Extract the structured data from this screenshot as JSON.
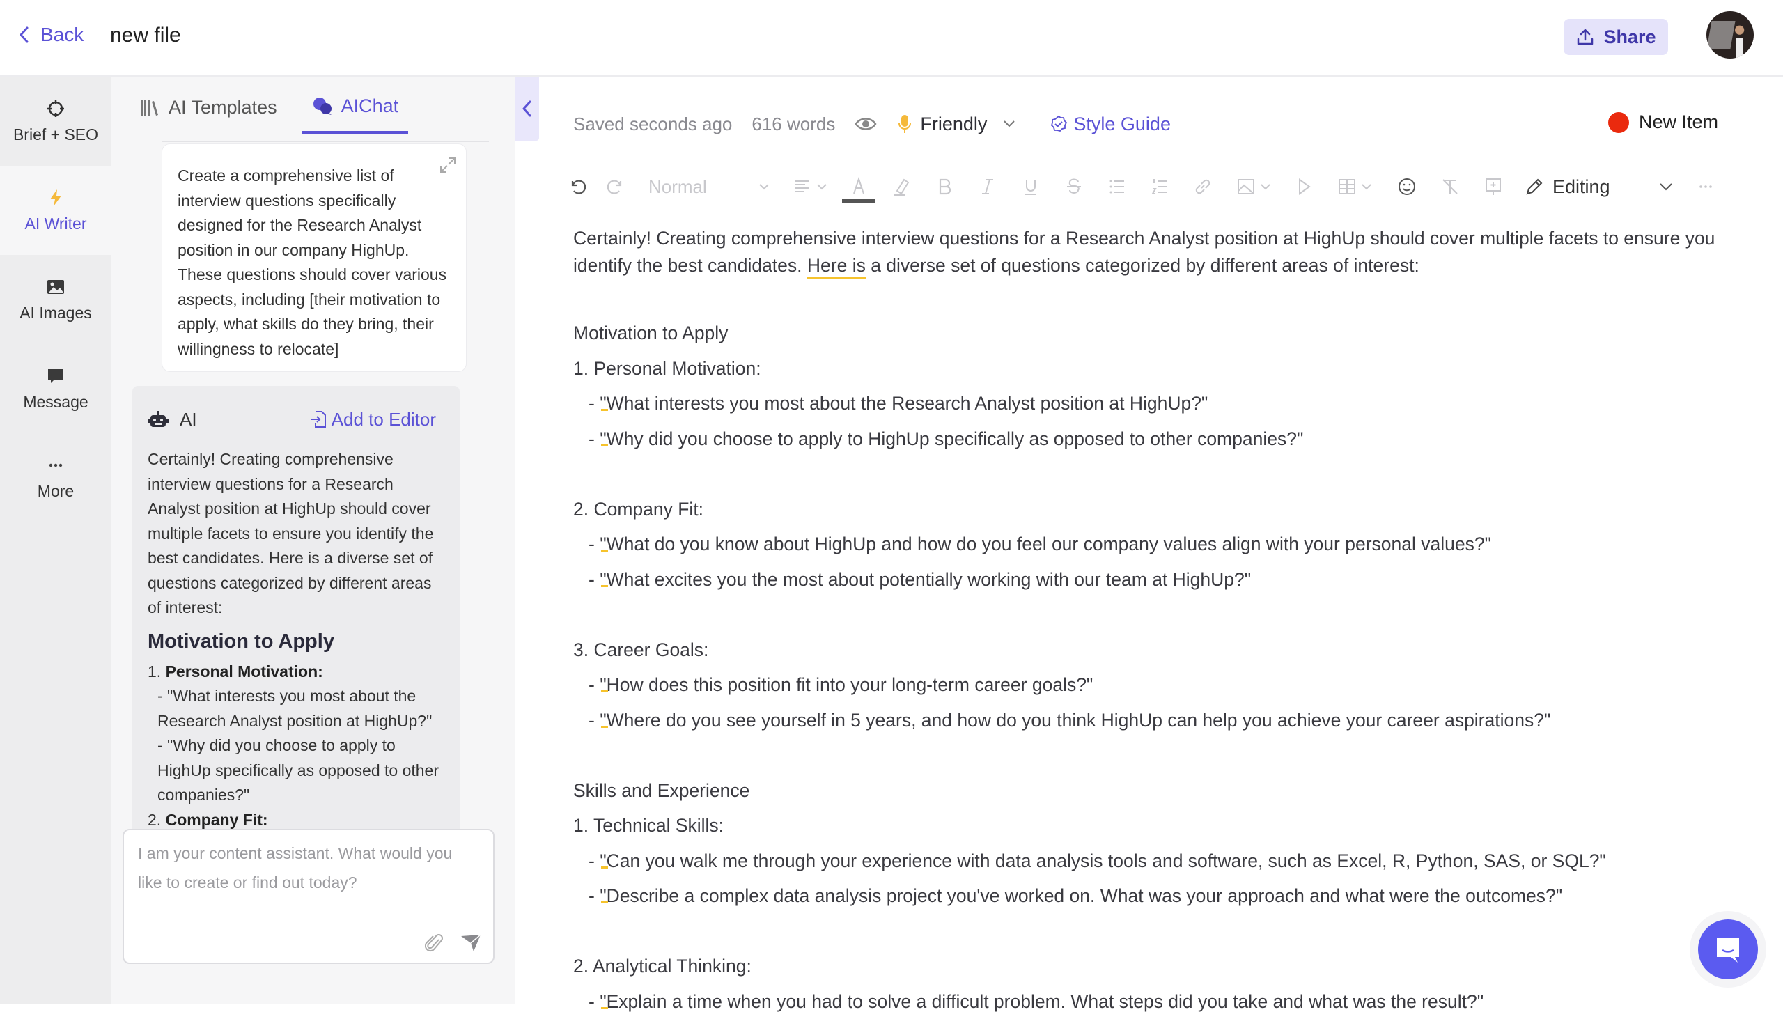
{
  "header": {
    "back_label": "Back",
    "file_title": "new file",
    "share_label": "Share"
  },
  "leftnav": {
    "items": [
      {
        "label": "Brief + SEO",
        "icon": "crosshair-icon"
      },
      {
        "label": "AI Writer",
        "icon": "lightning-icon",
        "active": true
      },
      {
        "label": "AI Images",
        "icon": "image-icon"
      },
      {
        "label": "Message",
        "icon": "chat-bubble-icon"
      },
      {
        "label": "More",
        "icon": "more-dots-icon"
      }
    ]
  },
  "chatpanel": {
    "tabs": [
      {
        "label": "AI Templates",
        "icon": "library-icon"
      },
      {
        "label": "AIChat",
        "icon": "chat-icon",
        "active": true
      }
    ],
    "prompt": "Create a comprehensive list of interview questions specifically designed for the Research Analyst position in our company HighUp. These questions should cover various aspects, including [their motivation to apply, what skills do they bring, their willingness to relocate]",
    "ai_label": "AI",
    "add_to_editor_label": "Add to Editor",
    "ai_intro": "Certainly! Creating comprehensive interview questions for a Research Analyst position at HighUp should cover multiple facets to ensure you identify the best candidates. Here is a diverse set of questions categorized by different areas of interest:",
    "ai_heading": "Motivation to Apply",
    "ai_item1_num": "1.",
    "ai_item1_title": "Personal Motivation:",
    "ai_item1_q1": "- \"What interests you most about the Research Analyst position at HighUp?\"",
    "ai_item1_q2": "- \"Why did you choose to apply to HighUp specifically as opposed to other companies?\"",
    "ai_item2_num": "2.",
    "ai_item2_title": "Company Fit:",
    "input_placeholder": "I am your content assistant. What would you like to create or find out today?"
  },
  "editor": {
    "saved_status": "Saved seconds ago",
    "word_count": "616 words",
    "tone": "Friendly",
    "style_guide_label": "Style Guide",
    "new_item_label": "New Item",
    "new_item_color": "#ea2a0e",
    "toolbar": {
      "paragraph_style": "Normal",
      "mode_label": "Editing"
    },
    "intro_a": "Certainly! Creating comprehensive interview questions for a Research Analyst position at HighUp should cover multiple facets to ensure you identify the best candidates. ",
    "intro_here": "Here is",
    "intro_b": " a diverse set of questions categorized by different areas of interest:",
    "sections": {
      "s1_title": "Motivation to Apply",
      "s1_i1": "1. Personal Motivation:",
      "s1_i1_q1": "\"What interests you most about the Research Analyst position at HighUp?\"",
      "s1_i1_q2": "\"Why did you choose to apply to HighUp specifically as opposed to other companies?\"",
      "s1_i2": "2. Company Fit:",
      "s1_i2_q1": "\"What do you know about HighUp and how do you feel our company values align with your personal values?\"",
      "s1_i2_q2": "\"What excites you the most about potentially working with our team at HighUp?\"",
      "s1_i3": "3. Career Goals:",
      "s1_i3_q1": "\"How does this position fit into your long-term career goals?\"",
      "s1_i3_q2": "\"Where do you see yourself in 5 years, and how do you think HighUp can help you achieve your career aspirations?\"",
      "s2_title": "Skills and Experience",
      "s2_i1": "1. Technical Skills:",
      "s2_i1_q1": "\"Can you walk me through your experience with data analysis tools and software, such as Excel, R, Python, SAS, or SQL?\"",
      "s2_i1_q2": "\"Describe a complex data analysis project you've worked on. What was your approach and what were the outcomes?\"",
      "s2_i2": "2. Analytical Thinking:",
      "s2_i2_q1": "\"Explain a time when you had to solve a difficult problem. What steps did you take and what was the result?\""
    }
  },
  "colors": {
    "accent": "#5b52d6",
    "share_bg": "#e5e3fa",
    "highlight_underline": "#f6c32d",
    "support_bubble": "#5b5bf0"
  }
}
